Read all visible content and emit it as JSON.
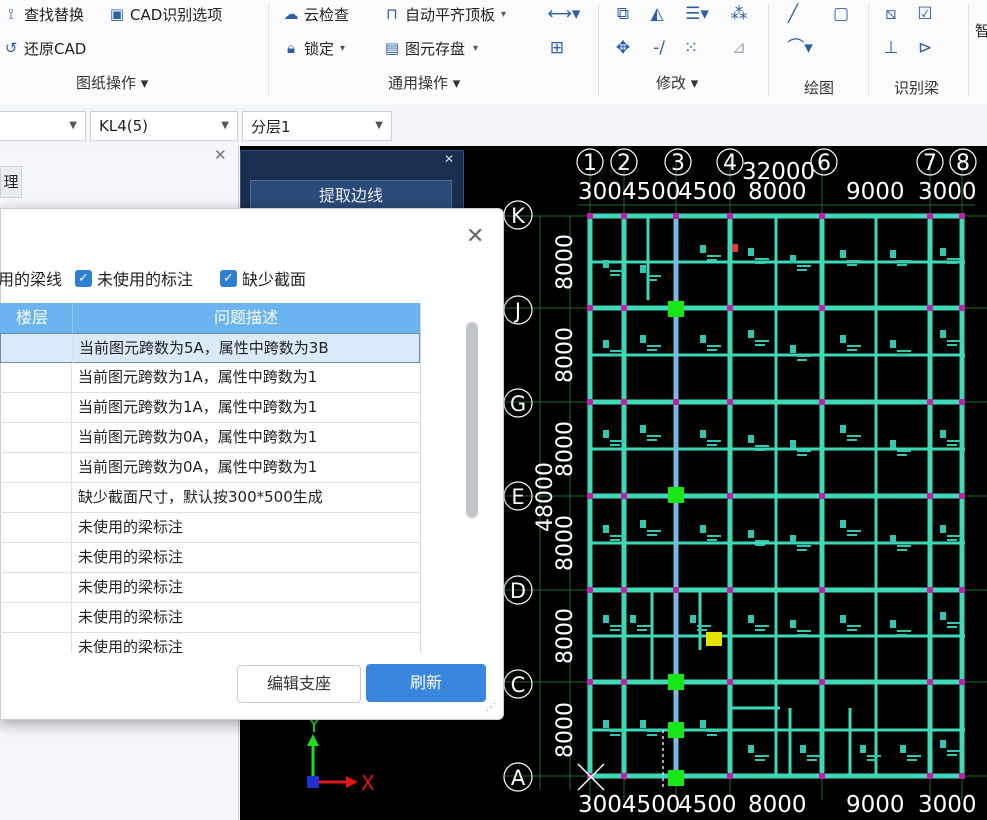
{
  "ribbon": {
    "buttons": {
      "find_replace": "查找替换",
      "cad_options": "CAD识别选项",
      "restore_cad": "还原CAD",
      "cloud_check": "云检查",
      "auto_align_top": "自动平齐顶板",
      "lock": "锁定",
      "element_save": "图元存盘"
    },
    "groups": {
      "drawing_ops": "图纸操作",
      "common_ops": "通用操作",
      "modify": "修改",
      "draw": "绘图",
      "recognize_beam": "识别梁"
    },
    "cut_label": "智"
  },
  "selectors": {
    "beam": "KL4(5)",
    "layer": "分层1"
  },
  "left_panel": {
    "tab_char": "理"
  },
  "dark_panel": {
    "extract_edge": "提取边线"
  },
  "dialog": {
    "checkboxes": [
      "用的梁线",
      "未使用的标注",
      "缺少截面"
    ],
    "columns": [
      "楼层",
      "问题描述"
    ],
    "rows": [
      "当前图元跨数为5A，属性中跨数为3B",
      "当前图元跨数为1A，属性中跨数为1",
      "当前图元跨数为1A，属性中跨数为1",
      "当前图元跨数为0A，属性中跨数为1",
      "当前图元跨数为0A，属性中跨数为1",
      "缺少截面尺寸，默认按300*500生成",
      "未使用的梁标注",
      "未使用的梁标注",
      "未使用的梁标注",
      "未使用的梁标注",
      "未使用的梁标注"
    ],
    "edit_support": "编辑支座",
    "refresh": "刷新"
  },
  "cad": {
    "col_labels": [
      "1",
      "2",
      "3",
      "4",
      "6",
      "7",
      "8"
    ],
    "row_labels": [
      "K",
      "J",
      "G",
      "E",
      "D",
      "C",
      "A"
    ],
    "top_dims": [
      "3004500",
      "4500",
      "8000",
      "9000",
      "3000"
    ],
    "top_total": "32000",
    "bottom_dims": [
      "3004500",
      "4500",
      "8000",
      "9000",
      "3000"
    ],
    "side_dims": [
      "8000",
      "8000",
      "8000",
      "8000",
      "8000",
      "8000"
    ],
    "side_total": "48000",
    "axis_y": "Y",
    "axis_x": "X"
  }
}
